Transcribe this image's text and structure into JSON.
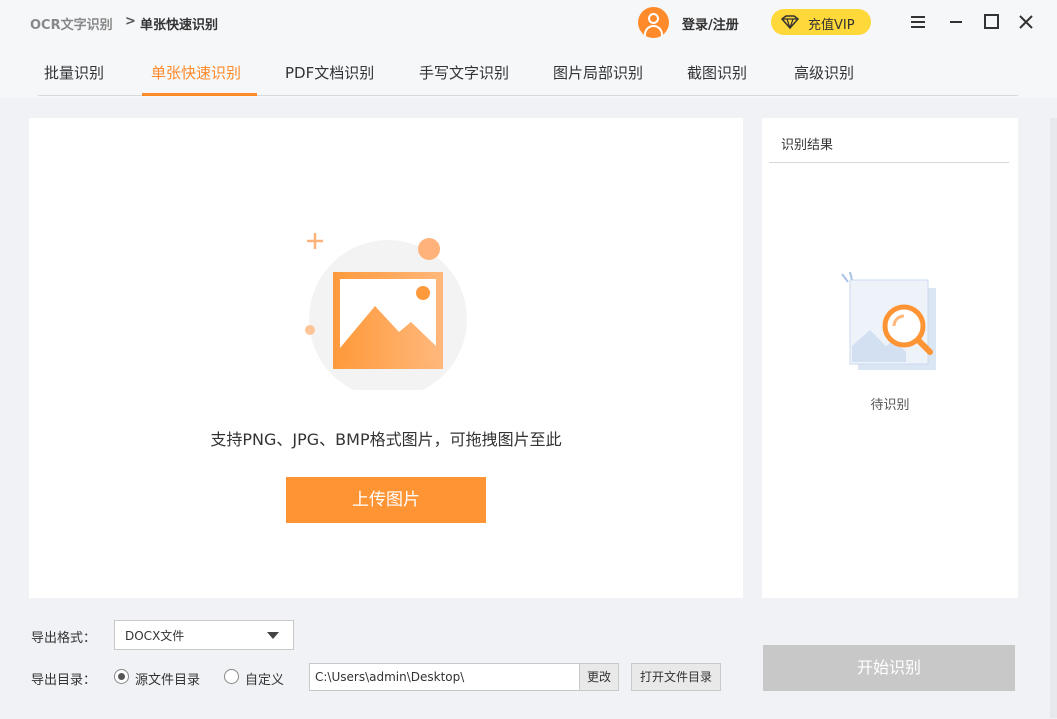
{
  "titlebar": {
    "app_name": "OCR文字识别",
    "separator": ">",
    "current_page": "单张快速识别",
    "login_label": "登录/注册",
    "vip_label": "充值VIP"
  },
  "tabs": [
    {
      "label": "批量识别",
      "active": false
    },
    {
      "label": "单张快速识别",
      "active": true
    },
    {
      "label": "PDF文档识别",
      "active": false
    },
    {
      "label": "手写文字识别",
      "active": false
    },
    {
      "label": "图片局部识别",
      "active": false
    },
    {
      "label": "截图识别",
      "active": false
    },
    {
      "label": "高级识别",
      "active": false
    }
  ],
  "upload": {
    "hint": "支持PNG、JPG、BMP格式图片，可拖拽图片至此",
    "button_label": "上传图片"
  },
  "result": {
    "title": "识别结果",
    "status": "待识别"
  },
  "export": {
    "format_label": "导出格式：",
    "format_value": "DOCX文件",
    "dir_label": "导出目录：",
    "option_source": "源文件目录",
    "option_custom": "自定义",
    "selected_option": "source",
    "path_value": "C:\\Users\\admin\\Desktop\\",
    "change_label": "更改",
    "open_dir_label": "打开文件目录"
  },
  "start_button": "开始识别",
  "colors": {
    "accent": "#ff8a2a",
    "vip": "#ffd83a",
    "disabled": "#c8c8c8"
  }
}
